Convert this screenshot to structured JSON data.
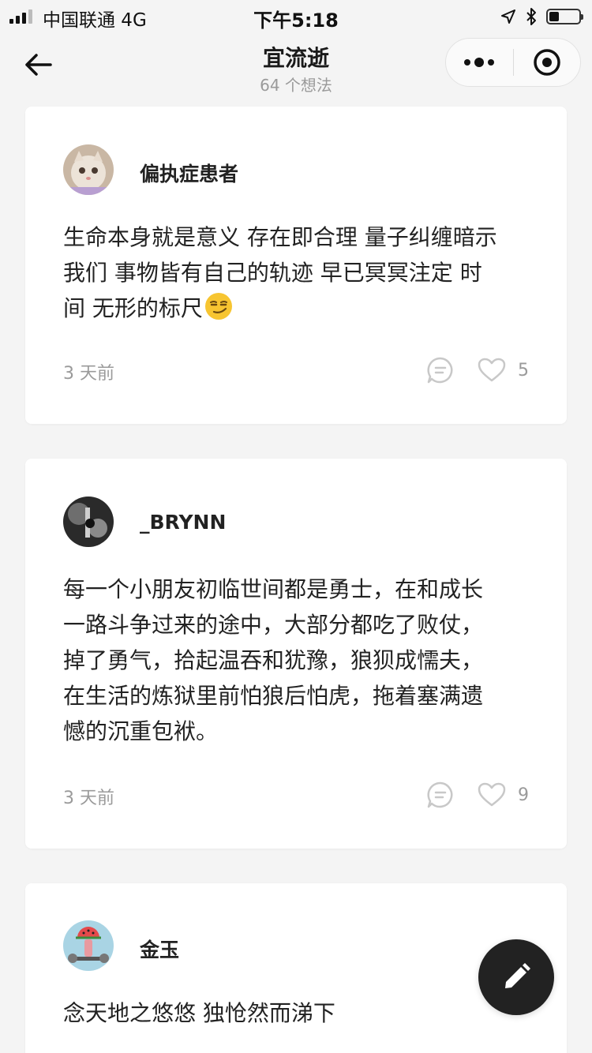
{
  "status_bar": {
    "carrier": "中国联通  4G",
    "time": "下午5:18"
  },
  "nav": {
    "title": "宜流逝",
    "subtitle": "64 个想法"
  },
  "posts": [
    {
      "username": "偏执症患者",
      "avatar_icon": "cat-avatar",
      "text_lines": [
        "生命本身就是意义 存在即合理 量子纠缠暗示",
        "我们 事物皆有自己的轨迹 早已冥冥注定 时",
        "间 无形的标尺"
      ],
      "emoji_icon": "smirk-emoji",
      "time": "3 天前",
      "likes": "5"
    },
    {
      "username": "_BRYNN",
      "avatar_icon": "dark-photo-avatar",
      "text_lines": [
        "每一个小朋友初临世间都是勇士，在和成长",
        "一路斗争过来的途中，大部分都吃了败仗，",
        "掉了勇气，拾起温吞和犹豫，狼狈成懦夫，",
        "在生活的炼狱里前怕狼后怕虎，拖着塞满遗",
        "憾的沉重包袱。"
      ],
      "time": "3 天前",
      "likes": "9"
    },
    {
      "username": "金玉",
      "avatar_icon": "watermelon-avatar",
      "text_lines": [
        "念天地之悠悠 独怆然而涕下"
      ]
    }
  ],
  "colors": {
    "background": "#f4f4f4",
    "card": "#ffffff",
    "muted_text": "#9a9a9a",
    "fab": "#222222"
  }
}
